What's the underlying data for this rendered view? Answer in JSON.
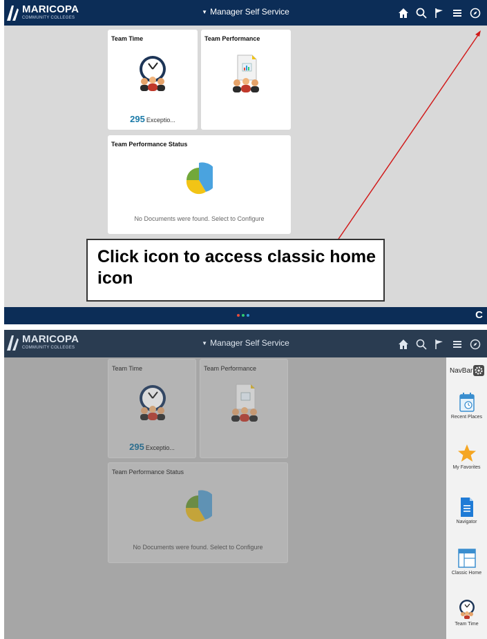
{
  "top": {
    "header": {
      "logo_main": "MARICOPA",
      "logo_sub": "COMMUNITY COLLEGES",
      "title": "Manager Self Service",
      "icons": [
        "home-icon",
        "search-icon",
        "flag-icon",
        "menu-icon",
        "navbar-compass-icon"
      ]
    },
    "tiles": {
      "team_time": {
        "title": "Team Time",
        "count": "295",
        "count_label": "Exceptio..."
      },
      "team_performance": {
        "title": "Team Performance"
      },
      "team_performance_status": {
        "title": "Team Performance Status",
        "message": "No Documents were found. Select to Configure"
      }
    },
    "callout": {
      "text": "Click icon to access classic home icon"
    },
    "footer": {
      "refresh_icon": "refresh-icon",
      "page_dots": 3
    }
  },
  "bottom": {
    "header": {
      "logo_main": "MARICOPA",
      "logo_sub": "COMMUNITY COLLEGES",
      "title": "Manager Self Service"
    },
    "tiles": {
      "team_time": {
        "title": "Team Time",
        "count": "295",
        "count_label": "Exceptio..."
      },
      "team_performance": {
        "title": "Team Performance"
      },
      "team_performance_status": {
        "title": "Team Performance Status",
        "message": "No Documents were found. Select to Configure"
      }
    },
    "navbar": {
      "title": "NavBar",
      "items": [
        {
          "label": "Recent Places",
          "icon": "calendar-clock-icon"
        },
        {
          "label": "My Favorites",
          "icon": "star-icon"
        },
        {
          "label": "Navigator",
          "icon": "document-icon"
        },
        {
          "label": "Classic Home",
          "icon": "window-icon"
        },
        {
          "label": "Team Time",
          "icon": "clock-team-icon"
        }
      ]
    }
  },
  "colors": {
    "header_bg": "#0c2d57",
    "accent_number": "#1a7aa8",
    "pie_blue": "#4aa3df",
    "pie_yellow": "#f2c416",
    "pie_green": "#72a83a",
    "arrow_red": "#d11b1b"
  }
}
